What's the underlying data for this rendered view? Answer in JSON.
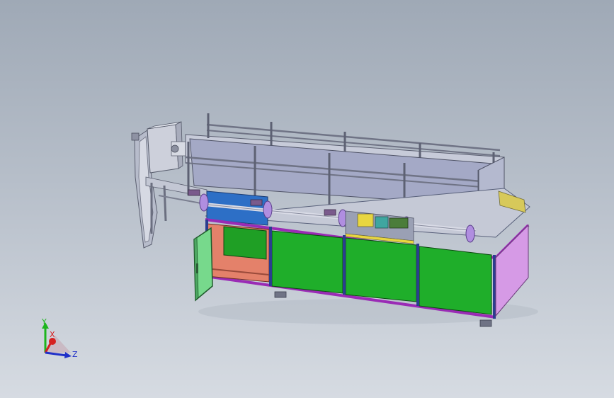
{
  "viewport": {
    "background_top": "#9fa9b6",
    "background_bottom": "#d6dbe2"
  },
  "model": {
    "colors": {
      "frame": "#9a2bb5",
      "panel_green": "#1fae2a",
      "door_green": "#77d98c",
      "side_panel": "#d69ae6",
      "cabinet_interior": "#e4816a",
      "hopper_gray": "#a2a7c4",
      "motor_gray": "#c9cdd8",
      "blue_panel": "#2d6fc6",
      "roller_lavender": "#b08ee0",
      "yellow_part": "#e8d640"
    }
  },
  "triad": {
    "y_label": "Y",
    "x_label": "X",
    "z_label": "Z",
    "y_color": "#1db51d",
    "x_color": "#d62020",
    "z_color": "#2030c8"
  }
}
